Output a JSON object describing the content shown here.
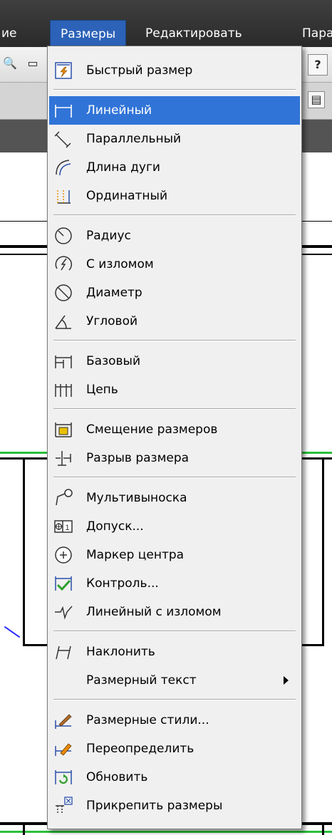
{
  "menubar": {
    "items": [
      {
        "label": "ие"
      },
      {
        "label": "Размеры"
      },
      {
        "label": "Редактировать"
      },
      {
        "label": "Пара"
      }
    ]
  },
  "background": {
    "help_glyph": "?"
  },
  "dropdown": {
    "items": [
      {
        "label": "Быстрый размер",
        "icon": "quick-dimension-icon"
      },
      {
        "label": "Линейный",
        "icon": "linear-dimension-icon",
        "selected": true
      },
      {
        "label": "Параллельный",
        "icon": "aligned-dimension-icon"
      },
      {
        "label": "Длина дуги",
        "icon": "arc-length-icon"
      },
      {
        "label": "Ординатный",
        "icon": "ordinate-dimension-icon"
      },
      {
        "label": "Радиус",
        "icon": "radius-icon"
      },
      {
        "label": "С изломом",
        "icon": "jogged-radius-icon"
      },
      {
        "label": "Диаметр",
        "icon": "diameter-icon"
      },
      {
        "label": "Угловой",
        "icon": "angular-dimension-icon"
      },
      {
        "label": "Базовый",
        "icon": "baseline-dimension-icon"
      },
      {
        "label": "Цепь",
        "icon": "continue-dimension-icon"
      },
      {
        "label": "Смещение размеров",
        "icon": "dimension-space-icon"
      },
      {
        "label": "Разрыв размера",
        "icon": "dimension-break-icon"
      },
      {
        "label": "Мультивыноска",
        "icon": "multileader-icon"
      },
      {
        "label": "Допуск...",
        "icon": "tolerance-icon"
      },
      {
        "label": "Маркер центра",
        "icon": "center-mark-icon"
      },
      {
        "label": "Контроль...",
        "icon": "inspection-icon"
      },
      {
        "label": "Линейный с изломом",
        "icon": "jogged-linear-icon"
      },
      {
        "label": "Наклонить",
        "icon": "oblique-icon"
      },
      {
        "label": "Размерный текст",
        "icon": "",
        "submenu": true
      },
      {
        "label": "Размерные стили...",
        "icon": "dimension-style-icon"
      },
      {
        "label": "Переопределить",
        "icon": "override-icon"
      },
      {
        "label": "Обновить",
        "icon": "update-icon"
      },
      {
        "label": "Прикрепить размеры",
        "icon": "reassociate-icon"
      }
    ]
  },
  "colors": {
    "selection": "#3174d8",
    "menubar_active": "#2c62b8",
    "icon_blue": "#2a4fa8",
    "icon_orange": "#e88a00",
    "icon_green": "#2f9e2f"
  }
}
